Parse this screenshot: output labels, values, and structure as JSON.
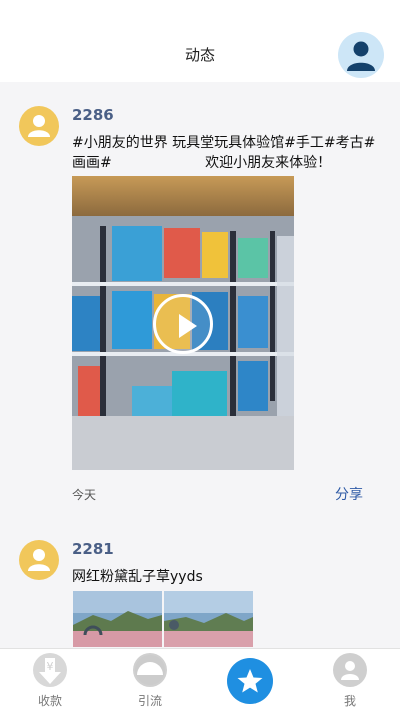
{
  "header": {
    "title": "动态"
  },
  "posts": [
    {
      "username": "2286",
      "text": "#小朋友的世界 玩具堂玩具体验馆#手工#考古#画画#                     欢迎小朋友来体验！",
      "time": "今天",
      "share_label": "分享"
    },
    {
      "username": "2281",
      "text": "网红粉黛乱子草yyds"
    }
  ],
  "tabbar": {
    "items": [
      {
        "label": "收款",
        "icon": "yuan-download-icon"
      },
      {
        "label": "引流",
        "icon": "half-circle-icon"
      },
      {
        "label": "",
        "icon": "star-icon"
      },
      {
        "label": "我",
        "icon": "user-icon"
      }
    ]
  },
  "colors": {
    "accent": "#1f8fe1",
    "username": "#4a5f86",
    "avatar_yellow": "#f1c75b",
    "share": "#2e5aa6"
  }
}
